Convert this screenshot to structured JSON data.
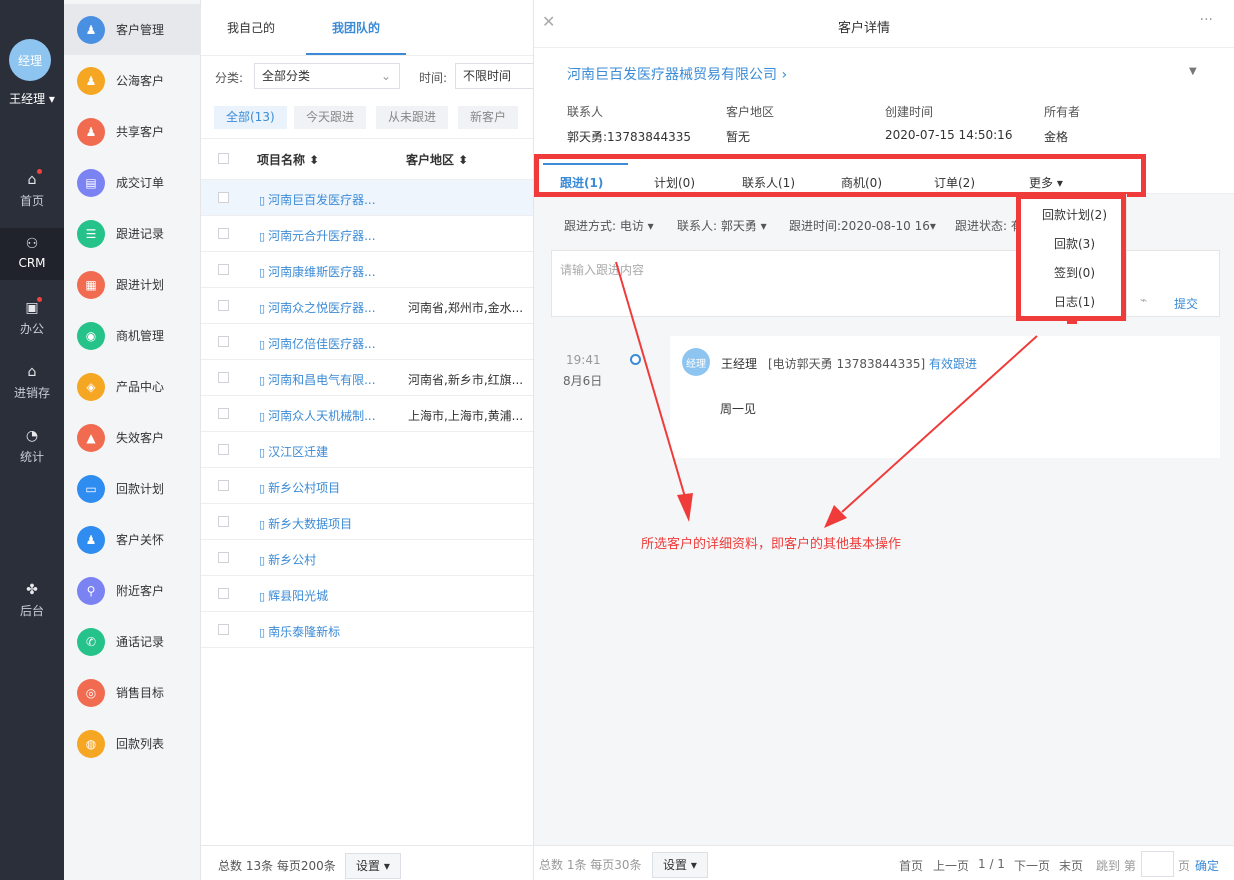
{
  "rail": {
    "avatar_text": "经理",
    "user_name": "王经理 ▾",
    "items": [
      {
        "label": "首页",
        "icon": "home-icon"
      },
      {
        "label": "CRM",
        "icon": "crm-icon"
      },
      {
        "label": "办公",
        "icon": "office-icon"
      },
      {
        "label": "进销存",
        "icon": "inventory-icon"
      },
      {
        "label": "统计",
        "icon": "stats-icon"
      },
      {
        "label": "后台",
        "icon": "admin-icon"
      }
    ]
  },
  "menu": {
    "items": [
      {
        "label": "客户管理",
        "icon": "customer-icon",
        "color": "#4a90e2"
      },
      {
        "label": "公海客户",
        "icon": "public-customer-icon",
        "color": "#f5a623"
      },
      {
        "label": "共享客户",
        "icon": "share-customer-icon",
        "color": "#f06b4f"
      },
      {
        "label": "成交订单",
        "icon": "order-icon",
        "color": "#7b83f3"
      },
      {
        "label": "跟进记录",
        "icon": "followup-record-icon",
        "color": "#25c28a"
      },
      {
        "label": "跟进计划",
        "icon": "followup-plan-icon",
        "color": "#f06b4f"
      },
      {
        "label": "商机管理",
        "icon": "opportunity-icon",
        "color": "#25c28a"
      },
      {
        "label": "产品中心",
        "icon": "product-icon",
        "color": "#f5a623"
      },
      {
        "label": "失效客户",
        "icon": "invalid-customer-icon",
        "color": "#f06b4f"
      },
      {
        "label": "回款计划",
        "icon": "payment-plan-icon",
        "color": "#2f8cf0"
      },
      {
        "label": "客户关怀",
        "icon": "customer-care-icon",
        "color": "#2f8cf0"
      },
      {
        "label": "附近客户",
        "icon": "nearby-icon",
        "color": "#7b83f3"
      },
      {
        "label": "通话记录",
        "icon": "call-record-icon",
        "color": "#25c28a"
      },
      {
        "label": "销售目标",
        "icon": "sales-target-icon",
        "color": "#f06b4f"
      },
      {
        "label": "回款列表",
        "icon": "payment-list-icon",
        "color": "#f5a623"
      }
    ]
  },
  "list": {
    "tabs": [
      "我自己的",
      "我团队的"
    ],
    "filter_label": "分类:",
    "filter_value": "全部分类",
    "time_label": "时间:",
    "time_value": "不限时间",
    "chips": [
      "全部(13)",
      "今天跟进",
      "从未跟进",
      "新客户"
    ],
    "col_name": "项目名称 ⬍",
    "col_region": "客户地区 ⬍",
    "rows": [
      {
        "name": "河南巨百发医疗器...",
        "region": ""
      },
      {
        "name": "河南元合升医疗器...",
        "region": ""
      },
      {
        "name": "河南康维斯医疗器...",
        "region": ""
      },
      {
        "name": "河南众之悦医疗器...",
        "region": "河南省,郑州市,金水..."
      },
      {
        "name": "河南亿倍佳医疗器...",
        "region": ""
      },
      {
        "name": "河南和昌电气有限...",
        "region": "河南省,新乡市,红旗..."
      },
      {
        "name": "河南众人天机械制...",
        "region": "上海市,上海市,黄浦..."
      },
      {
        "name": "汉江区迁建",
        "region": ""
      },
      {
        "name": "新乡公村项目",
        "region": ""
      },
      {
        "name": "新乡大数据项目",
        "region": ""
      },
      {
        "name": "新乡公村",
        "region": ""
      },
      {
        "name": "辉县阳光城",
        "region": ""
      },
      {
        "name": "南乐泰隆新标",
        "region": ""
      }
    ],
    "footer_text": "总数 13条 每页200条",
    "settings_label": "设置 ▾"
  },
  "detail": {
    "title": "客户详情",
    "company": "河南巨百发医疗器械贸易有限公司 ›",
    "info": [
      {
        "label": "联系人",
        "value": "郭天勇:13783844335"
      },
      {
        "label": "客户地区",
        "value": "暂无"
      },
      {
        "label": "创建时间",
        "value": "2020-07-15 14:50:16"
      },
      {
        "label": "所有者",
        "value": "金格"
      }
    ],
    "tabs": [
      "跟进(1)",
      "计划(0)",
      "联系人(1)",
      "商机(0)",
      "订单(2)",
      "更多 ▾"
    ],
    "more_menu": [
      "回款计划(2)",
      "回款(3)",
      "签到(0)",
      "日志(1)"
    ],
    "followup_filters": [
      "跟进方式: 电访 ▾",
      "联系人: 郭天勇 ▾",
      "跟进时间:2020-08-10 16▾",
      "跟进状态: 有"
    ],
    "input_placeholder": "请输入跟进内容",
    "submit_label": "提交",
    "record": {
      "time": "19:41",
      "date": "8月6日",
      "avatar": "经理",
      "author": "王经理",
      "call_info": "[电访郭天勇 13783844335]",
      "status": "有效跟进",
      "content": "周一见"
    },
    "annotation": "所选客户的详细资料，即客户的其他基本操作",
    "footer_text": "总数 1条 每页30条",
    "settings_label": "设置 ▾",
    "pager": {
      "first": "首页",
      "prev": "上一页",
      "page": "1 / 1",
      "next": "下一页",
      "last": "末页",
      "jump": "跳到 第",
      "unit": "页",
      "confirm": "确定"
    }
  },
  "colors": {
    "accent": "#3b8bd6",
    "annotation": "#ef3b39"
  }
}
